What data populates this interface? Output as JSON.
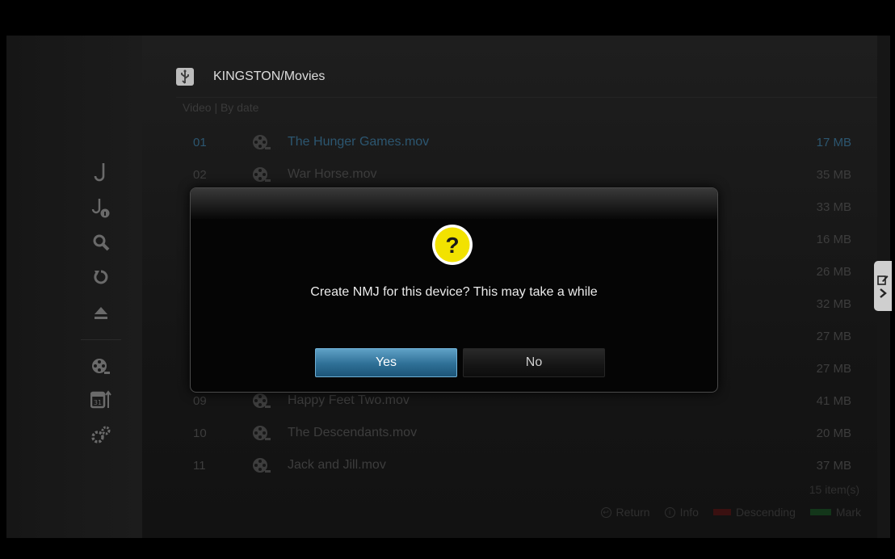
{
  "header": {
    "title": "KINGSTON/Movies",
    "usb_icon": "usb-icon",
    "sub": "Video | By date"
  },
  "files": [
    {
      "num": "01",
      "name": "The Hunger Games.mov",
      "size": "17 MB",
      "selected": true
    },
    {
      "num": "02",
      "name": "War Horse.mov",
      "size": "35 MB"
    },
    {
      "num": "",
      "name": "",
      "size": "33 MB"
    },
    {
      "num": "",
      "name": "",
      "size": "16 MB"
    },
    {
      "num": "",
      "name": "",
      "size": "26 MB"
    },
    {
      "num": "",
      "name": "",
      "size": "32 MB"
    },
    {
      "num": "",
      "name": "",
      "size": "27 MB"
    },
    {
      "num": "",
      "name": "",
      "size": "27 MB"
    },
    {
      "num": "09",
      "name": "Happy Feet Two.mov",
      "size": "41 MB"
    },
    {
      "num": "10",
      "name": "The Descendants.mov",
      "size": "20 MB"
    },
    {
      "num": "11",
      "name": "Jack and Jill.mov",
      "size": "37 MB"
    }
  ],
  "footer": {
    "count": "15 item(s)",
    "hints": {
      "return": "Return",
      "info": "Info",
      "descending": "Descending",
      "mark": "Mark"
    }
  },
  "sidebar_icons": [
    "music-note-icon",
    "music-info-icon",
    "search-icon",
    "refresh-icon",
    "eject-icon",
    "film-reel-icon",
    "calendar-sort-icon",
    "settings-gears-icon"
  ],
  "dialog": {
    "message": "Create NMJ for this device? This may take a while",
    "yes_label": "Yes",
    "no_label": "No",
    "icon": "question-icon"
  },
  "colors": {
    "selected_text": "#2c5670",
    "yes_button": "#2e6f96",
    "question_badge": "#f2e200"
  }
}
